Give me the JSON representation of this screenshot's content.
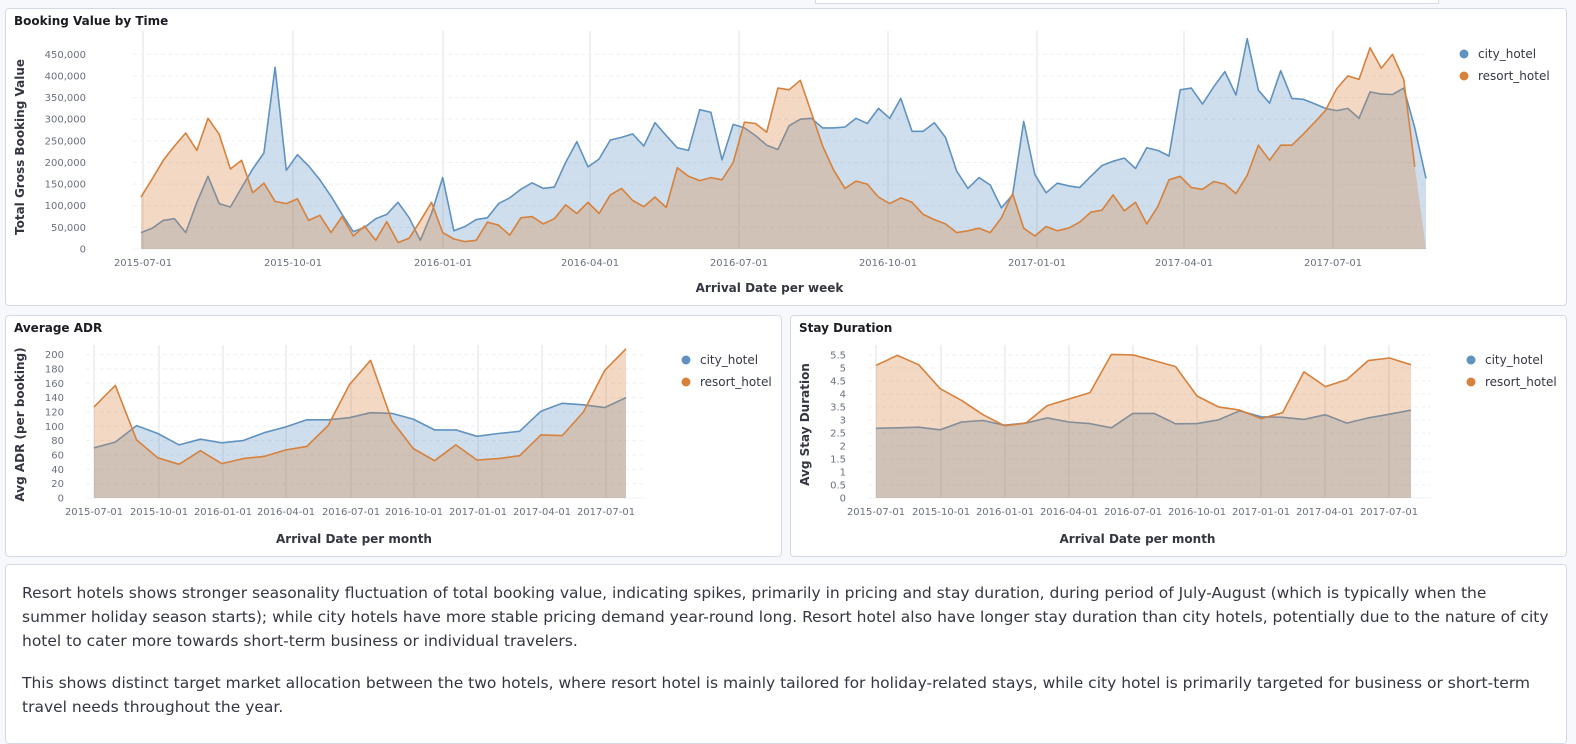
{
  "colors": {
    "city_hotel": "#6092c0",
    "resort_hotel": "#d6813c"
  },
  "panels": {
    "booking": {
      "title": "Booking Value by Time"
    },
    "adr": {
      "title": "Average ADR"
    },
    "stay": {
      "title": "Stay Duration"
    }
  },
  "chart_data": [
    {
      "id": "booking",
      "type": "area",
      "title": "Booking Value by Time",
      "xlabel": "Arrival Date per week",
      "ylabel": "Total Gross Booking Value",
      "x_ticks": [
        "2015-07-01",
        "2015-10-01",
        "2016-01-01",
        "2016-04-01",
        "2016-07-01",
        "2016-10-01",
        "2017-01-01",
        "2017-04-01",
        "2017-07-01"
      ],
      "y_ticks": [
        "0",
        "50,000",
        "100,000",
        "150,000",
        "200,000",
        "250,000",
        "300,000",
        "350,000",
        "400,000",
        "450,000"
      ],
      "ylim": [
        0,
        490000
      ],
      "grid": true,
      "legend_position": "top-right",
      "series": [
        {
          "name": "city_hotel",
          "values": [
            38000,
            48000,
            66000,
            70000,
            38000,
            108000,
            168000,
            105000,
            97000,
            142000,
            185000,
            222000,
            420000,
            182000,
            218000,
            192000,
            160000,
            122000,
            80000,
            40000,
            50000,
            70000,
            80000,
            108000,
            72000,
            20000,
            82000,
            165000,
            42000,
            52000,
            68000,
            72000,
            105000,
            118000,
            138000,
            153000,
            140000,
            143000,
            200000,
            248000,
            190000,
            208000,
            252000,
            258000,
            266000,
            238000,
            292000,
            262000,
            234000,
            228000,
            322000,
            316000,
            206000,
            288000,
            280000,
            262000,
            240000,
            230000,
            285000,
            300000,
            302000,
            280000,
            280000,
            282000,
            302000,
            290000,
            325000,
            302000,
            348000,
            272000,
            272000,
            292000,
            258000,
            180000,
            140000,
            165000,
            148000,
            95000,
            125000,
            295000,
            172000,
            130000,
            152000,
            146000,
            142000,
            168000,
            193000,
            203000,
            210000,
            186000,
            234000,
            228000,
            215000,
            368000,
            372000,
            335000,
            375000,
            410000,
            356000,
            486000,
            367000,
            337000,
            412000,
            348000,
            346000,
            336000,
            325000,
            320000,
            325000,
            302000,
            363000,
            358000,
            357000,
            372000,
            280000,
            163000
          ]
        },
        {
          "name": "resort_hotel",
          "values": [
            120000,
            162000,
            205000,
            238000,
            268000,
            228000,
            302000,
            265000,
            185000,
            205000,
            130000,
            152000,
            110000,
            105000,
            116000,
            66000,
            78000,
            38000,
            75000,
            30000,
            53000,
            20000,
            63000,
            15000,
            25000,
            65000,
            108000,
            38000,
            23000,
            17000,
            20000,
            62000,
            55000,
            32000,
            72000,
            75000,
            58000,
            70000,
            102000,
            82000,
            108000,
            82000,
            125000,
            140000,
            112000,
            98000,
            120000,
            96000,
            188000,
            168000,
            158000,
            165000,
            160000,
            200000,
            293000,
            290000,
            270000,
            372000,
            368000,
            390000,
            315000,
            238000,
            182000,
            140000,
            157000,
            150000,
            120000,
            105000,
            118000,
            108000,
            80000,
            68000,
            58000,
            38000,
            42000,
            48000,
            38000,
            72000,
            128000,
            48000,
            30000,
            52000,
            42000,
            48000,
            62000,
            85000,
            90000,
            125000,
            88000,
            108000,
            58000,
            98000,
            160000,
            168000,
            142000,
            138000,
            156000,
            150000,
            128000,
            170000,
            240000,
            205000,
            240000,
            240000,
            265000,
            292000,
            320000,
            370000,
            400000,
            392000,
            465000,
            418000,
            450000,
            392000,
            190000
          ]
        }
      ]
    },
    {
      "id": "adr",
      "type": "area",
      "title": "Average ADR",
      "xlabel": "Arrival Date per month",
      "ylabel": "Avg ADR (per booking)",
      "x_ticks": [
        "2015-07-01",
        "2015-10-01",
        "2016-01-01",
        "2016-04-01",
        "2016-07-01",
        "2016-10-01",
        "2017-01-01",
        "2017-04-01",
        "2017-07-01"
      ],
      "y_ticks": [
        "0",
        "20",
        "40",
        "60",
        "80",
        "100",
        "120",
        "140",
        "160",
        "180",
        "200"
      ],
      "ylim": [
        0,
        205
      ],
      "grid": true,
      "legend_position": "top-right",
      "series": [
        {
          "name": "city_hotel",
          "values": [
            70,
            78,
            101,
            90,
            74,
            82,
            77,
            80,
            91,
            99,
            109,
            109,
            112,
            119,
            118,
            110,
            95,
            95,
            86,
            90,
            93,
            121,
            132,
            130,
            126,
            140
          ]
        },
        {
          "name": "resort_hotel",
          "values": [
            127,
            157,
            81,
            56,
            47,
            66,
            48,
            55,
            58,
            67,
            72,
            101,
            158,
            192,
            108,
            69,
            52,
            74,
            53,
            55,
            59,
            88,
            87,
            120,
            178,
            208
          ]
        }
      ]
    },
    {
      "id": "stay",
      "type": "area",
      "title": "Stay Duration",
      "xlabel": "Arrival Date per month",
      "ylabel": "Avg Stay Duration",
      "x_ticks": [
        "2015-07-01",
        "2015-10-01",
        "2016-01-01",
        "2016-04-01",
        "2016-07-01",
        "2016-10-01",
        "2017-01-01",
        "2017-04-01",
        "2017-07-01"
      ],
      "y_ticks": [
        "0",
        "0.5",
        "1",
        "1.5",
        "2",
        "2.5",
        "3",
        "3.5",
        "4",
        "4.5",
        "5",
        "5.5"
      ],
      "ylim": [
        0,
        5.65
      ],
      "grid": true,
      "legend_position": "top-right",
      "series": [
        {
          "name": "city_hotel",
          "values": [
            2.68,
            2.7,
            2.72,
            2.62,
            2.92,
            2.98,
            2.8,
            2.88,
            3.08,
            2.92,
            2.86,
            2.7,
            3.25,
            3.25,
            2.85,
            2.86,
            3.0,
            3.35,
            3.12,
            3.1,
            3.02,
            3.2,
            2.88,
            3.08,
            3.22,
            3.38
          ]
        },
        {
          "name": "resort_hotel",
          "values": [
            5.1,
            5.48,
            5.12,
            4.2,
            3.75,
            3.2,
            2.78,
            2.88,
            3.55,
            3.8,
            4.05,
            5.52,
            5.5,
            5.28,
            5.05,
            3.92,
            3.5,
            3.38,
            3.05,
            3.28,
            4.85,
            4.28,
            4.55,
            5.28,
            5.38,
            5.12
          ]
        }
      ]
    }
  ],
  "narrative": {
    "paragraph1": "Resort hotels shows stronger seasonality fluctuation of total booking value, indicating spikes, primarily in pricing and stay duration, during period of July-August (which is typically when the summer holiday season starts); while city hotels have more stable pricing demand year-round long. Resort hotel also have longer stay duration than city hotels, potentially due to the nature of city hotel to cater more towards short-term business or individual travelers.",
    "paragraph2": "This shows distinct target market allocation between the two hotels, where resort hotel is mainly tailored for holiday-related stays, while city hotel is primarily targeted for business or short-term travel needs throughout the year."
  }
}
